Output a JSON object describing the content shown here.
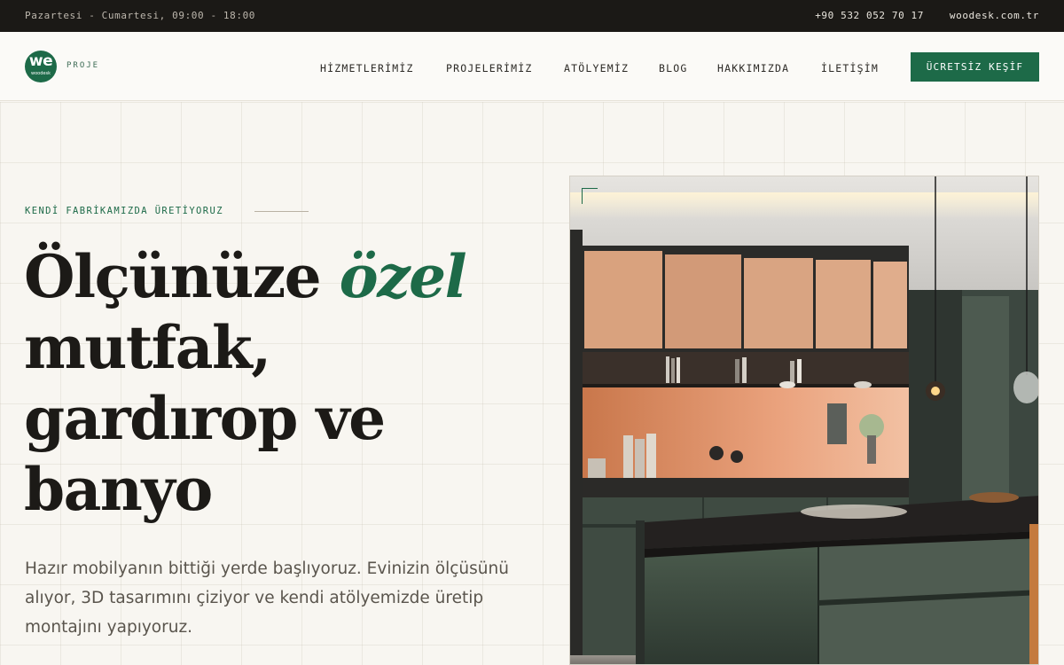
{
  "topbar": {
    "hours": "Pazartesi - Cumartesi, 09:00 - 18:00",
    "phone": "+90 532 052 70 17",
    "domain": "woodesk.com.tr"
  },
  "header": {
    "logo_mark": "we",
    "logo_sub": "woodesk",
    "logo_tag": "PROJE",
    "nav": [
      "HİZMETLERİMİZ",
      "PROJELERİMİZ",
      "ATÖLYEMİZ",
      "BLOG",
      "HAKKIMIZDA",
      "İLETİŞİM"
    ],
    "cta": "ÜCRETSİZ KEŞİF"
  },
  "hero": {
    "eyebrow": "KENDİ FABRİKAMIZDA ÜRETİYORUZ",
    "headline_start": "Ölçünüze",
    "headline_accent": "özel",
    "headline_line2": "mutfak,",
    "headline_line3": "gardırop ve",
    "headline_line4": "banyo",
    "lead": "Hazır mobilyanın bittiği yerde başlıyoruz. Evinizin ölçüsünü alıyor, 3D tasarımını çiziyor ve kendi atölyemizde üretip montajını yapıyoruz.",
    "image_subject": "kitchen-photo"
  },
  "colors": {
    "brand_green": "#1d6a48",
    "topbar_bg": "#1b1916",
    "page_bg": "#f8f6f1",
    "text_dark": "#1c1a17"
  }
}
